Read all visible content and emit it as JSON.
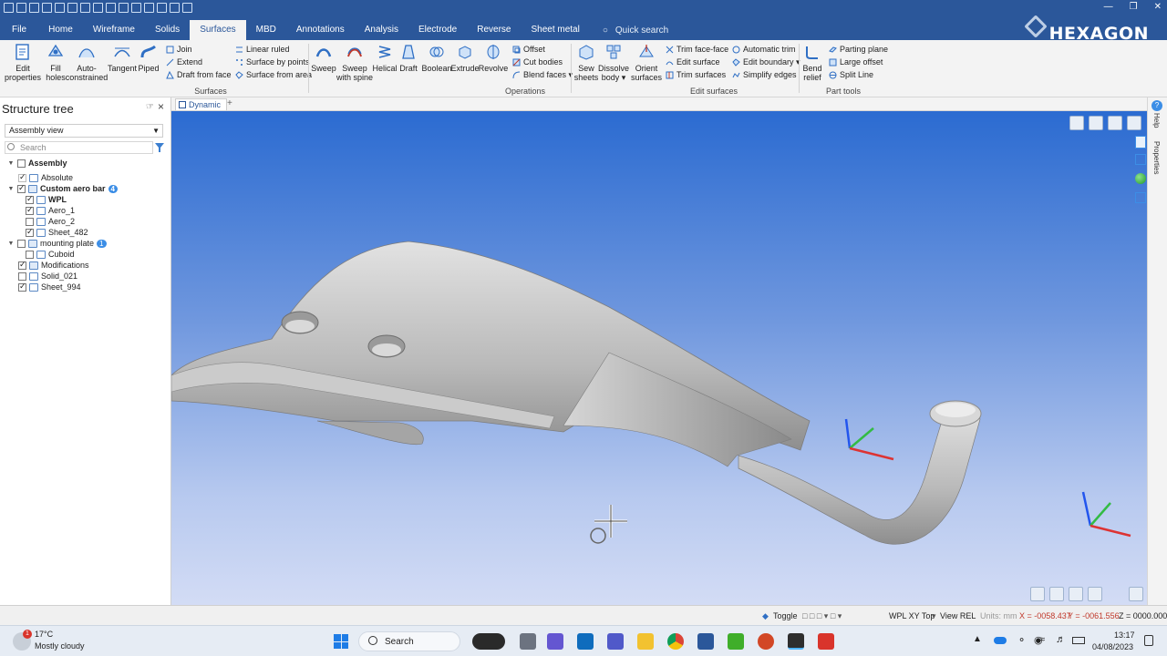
{
  "window": {
    "title_buttons": [
      "—",
      "❐",
      "✕"
    ],
    "brand": "HEXAGON"
  },
  "tabs": [
    {
      "label": "File"
    },
    {
      "label": "Home"
    },
    {
      "label": "Wireframe"
    },
    {
      "label": "Solids"
    },
    {
      "label": "Surfaces"
    },
    {
      "label": "MBD"
    },
    {
      "label": "Annotations"
    },
    {
      "label": "Analysis"
    },
    {
      "label": "Electrode"
    },
    {
      "label": "Reverse"
    },
    {
      "label": "Sheet metal"
    }
  ],
  "active_tab": "Surfaces",
  "quick_search": {
    "placeholder": "Quick search"
  },
  "ribbon": {
    "groups": {
      "surfaces": "Surfaces",
      "operations": "Operations",
      "edit_surfaces": "Edit surfaces",
      "part_tools": "Part tools"
    },
    "big": {
      "edit_properties": [
        "Edit",
        "properties"
      ],
      "fill_holes": [
        "Fill",
        "holes"
      ],
      "auto_constrained": [
        "Auto-",
        "constrained"
      ],
      "tangent": [
        "Tangent",
        ""
      ],
      "piped": [
        "Piped",
        ""
      ],
      "sweep": [
        "Sweep",
        ""
      ],
      "sweep_spine": [
        "Sweep",
        "with spine"
      ],
      "helical": [
        "Helical",
        ""
      ],
      "draft": [
        "Draft",
        ""
      ],
      "boolean": [
        "Boolean",
        ""
      ],
      "extrude": [
        "Extrude",
        ""
      ],
      "revolve": [
        "Revolve",
        ""
      ],
      "sew_sheets": [
        "Sew",
        "sheets"
      ],
      "dissolve_body": [
        "Dissolve",
        "body ▾"
      ],
      "orient_surfaces": [
        "Orient",
        "surfaces"
      ],
      "bend_relief": [
        "Bend",
        "relief"
      ]
    },
    "small": {
      "join": "Join",
      "extend": "Extend",
      "draft_from_face": "Draft from face",
      "linear_ruled": "Linear ruled",
      "surface_by_points": "Surface by points",
      "surface_from_area": "Surface from area",
      "offset": "Offset",
      "cut_bodies": "Cut bodies",
      "blend_faces": "Blend faces ▾",
      "trim_face_face": "Trim face-face",
      "edit_surface": "Edit surface",
      "trim_surfaces": "Trim surfaces",
      "automatic_trim": "Automatic trim",
      "edit_boundary": "Edit boundary ▾",
      "simplify_edges": "Simplify edges",
      "parting_plane": "Parting plane",
      "large_offset": "Large offset",
      "split_line": "Split Line"
    }
  },
  "structure_tree": {
    "title": "Structure tree",
    "view_select": "Assembly view",
    "search_placeholder": "Search",
    "nodes": [
      {
        "label": "Assembly",
        "badge": ""
      },
      {
        "label": "Absolute",
        "badge": ""
      },
      {
        "label": "Custom aero bar",
        "badge": "4"
      },
      {
        "label": "WPL",
        "badge": ""
      },
      {
        "label": "Aero_1",
        "badge": ""
      },
      {
        "label": "Aero_2",
        "badge": ""
      },
      {
        "label": "Sheet_482",
        "badge": ""
      },
      {
        "label": "mounting plate",
        "badge": "1"
      },
      {
        "label": "Cuboid",
        "badge": ""
      },
      {
        "label": "Modifications",
        "badge": ""
      },
      {
        "label": "Solid_021",
        "badge": ""
      },
      {
        "label": "Sheet_994",
        "badge": ""
      }
    ]
  },
  "document_tab": {
    "label": "Dynamic",
    "add": "+"
  },
  "right_strip": {
    "help": "Help",
    "properties": "Properties"
  },
  "statusbar": {
    "toggle": "Toggle",
    "wpl": "WPL XY Top",
    "view": "View REL",
    "units": "Units: mm",
    "x": "X = -0058.437",
    "y": "Y = -0061.556",
    "z": "Z = 0000.000"
  },
  "taskbar": {
    "weather_temp": "17°C",
    "weather_desc": "Mostly cloudy",
    "weather_alert": "1",
    "search": "Search",
    "time": "13:17",
    "date": "04/08/2023"
  }
}
